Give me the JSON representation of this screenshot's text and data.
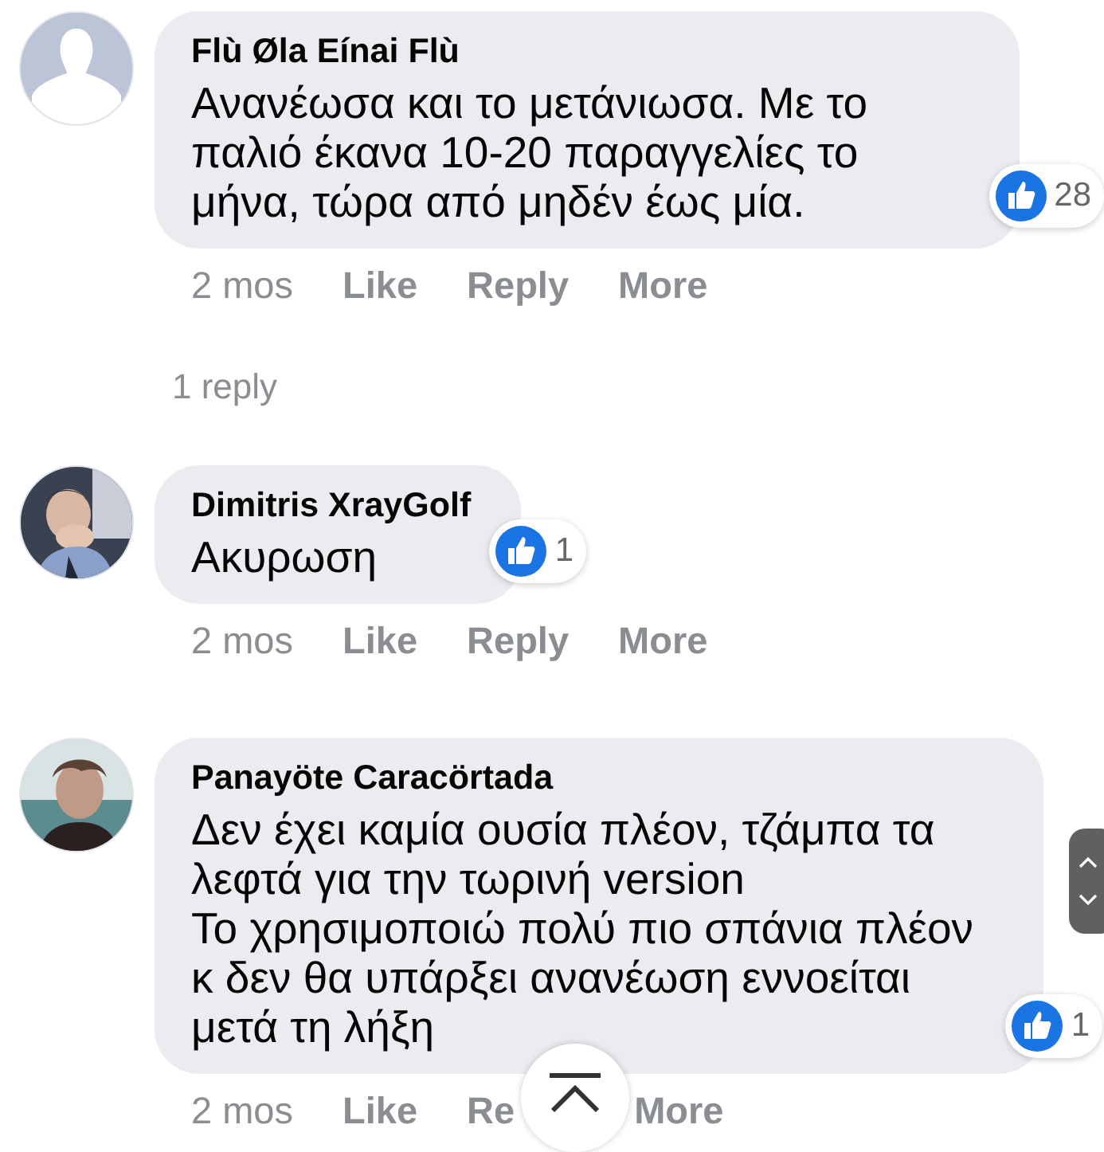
{
  "comments": [
    {
      "avatar": {
        "kind": "silhouette"
      },
      "author": "Flù Øla Eínai Flù",
      "lines": [
        "Ανανέωσα και το μετάνιωσα. Με το",
        "παλιό έκανα 10-20 παραγγελίες το",
        "μήνα, τώρα από μηδέν έως μία."
      ],
      "reactions": "28",
      "time": "2 mos",
      "actions": [
        "Like",
        "Reply",
        "More"
      ],
      "replies": "1 reply"
    },
    {
      "author": "Dimitris XrayGolf",
      "lines": [
        "Ακυρωση"
      ],
      "reactions": "1",
      "time": "2 mos",
      "actions": [
        "Like",
        "Reply",
        "More"
      ]
    },
    {
      "author": "Panayöte Caracörtada",
      "lines": [
        "Δεν έχει καμία ουσία πλέον, τζάμπα τα",
        "λεφτά για την τωρινή version",
        "Το χρησιμοποιώ πολύ πιο σπάνια πλέον",
        "κ δεν θα υπάρξει ανανέωση εννοείται",
        "μετά τη λήξη"
      ],
      "reactions": "1",
      "time": "2 mos",
      "actions": [
        "Like",
        "Re",
        "More"
      ]
    }
  ]
}
